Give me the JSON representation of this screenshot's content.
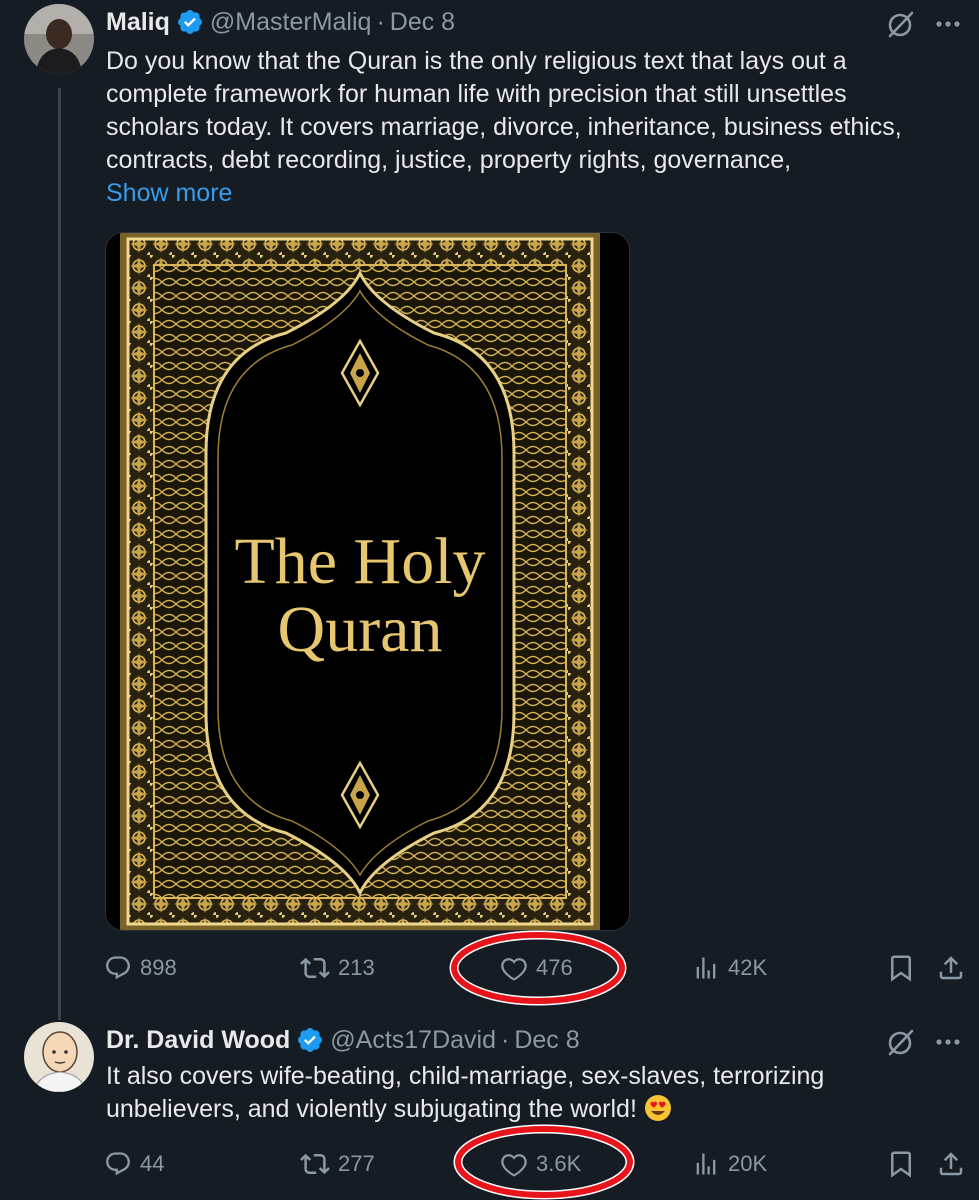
{
  "tweets": [
    {
      "author": {
        "name": "Maliq",
        "handle": "@MasterMaliq",
        "date": "Dec 8",
        "separator": "·"
      },
      "text_lines": [
        "Do you know that the Quran is the only religious text that lays out a",
        "complete framework for human life with precision that still unsettles",
        "scholars today. It covers marriage, divorce, inheritance, business ethics,",
        "contracts, debt recording, justice, property rights, governance,"
      ],
      "show_more": "Show more",
      "media": {
        "title_line1": "The Holy",
        "title_line2": "Quran"
      },
      "stats": {
        "replies": "898",
        "reposts": "213",
        "likes": "476",
        "views": "42K"
      }
    },
    {
      "author": {
        "name": "Dr. David Wood",
        "handle": "@Acts17David",
        "date": "Dec 8",
        "separator": "·"
      },
      "text_lines": [
        "It also covers wife-beating, child-marriage, sex-slaves, terrorizing",
        "unbelievers, and violently subjugating the world!"
      ],
      "emoji": "smiling-face-with-heart-eyes",
      "stats": {
        "replies": "44",
        "reposts": "277",
        "likes": "3.6K",
        "views": "20K"
      }
    }
  ],
  "colors": {
    "background": "#151c24",
    "text": "#e7e9ea",
    "muted": "#8b98a5",
    "link": "#3a9be8",
    "verified": "#1d9bf0",
    "highlight_circle": "#e8141c",
    "gold": "#d9b65a"
  },
  "icons": [
    "verified-badge-icon",
    "grok-icon",
    "more-icon",
    "reply-icon",
    "repost-icon",
    "like-icon",
    "views-icon",
    "bookmark-icon",
    "share-icon"
  ]
}
